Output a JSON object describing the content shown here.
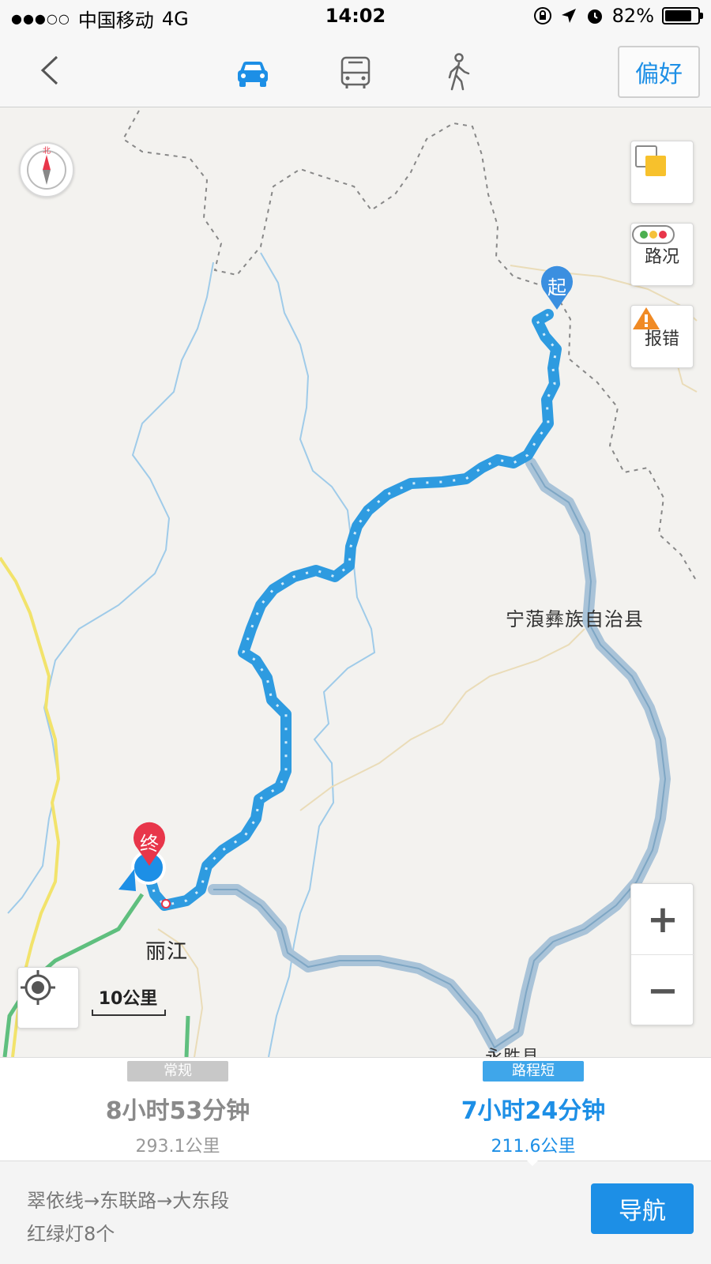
{
  "status_bar": {
    "signal": "●●●○○",
    "carrier": "中国移动",
    "network": "4G",
    "time": "14:02",
    "battery": "82%",
    "battery_fraction": 0.82
  },
  "nav": {
    "modes": [
      "car-icon",
      "bus-icon",
      "walk-icon"
    ],
    "active_mode": "car",
    "preference_label": "偏好"
  },
  "map": {
    "compass_label": "北",
    "county_label": "宁蒗彝族自治县",
    "city_label": "丽江",
    "bottom_label": "永胜县",
    "start_marker": "起",
    "end_marker": "终",
    "traffic_label": "路况",
    "report_label": "报错",
    "zoom_in": "+",
    "zoom_out": "−",
    "scale_text": "10公里"
  },
  "routes": [
    {
      "tag": "常规",
      "duration": "8小时53分钟",
      "distance": "293.1公里",
      "selected": false
    },
    {
      "tag": "路程短",
      "duration": "7小时24分钟",
      "distance": "211.6公里",
      "selected": true
    }
  ],
  "bottom": {
    "road_summary": "翠依线→东联路→大东段",
    "traffic_lights": "红绿灯8个",
    "navigate_label": "导航"
  },
  "colors": {
    "accent": "#1d8fe6",
    "route_main": "#2e9be0",
    "route_alt": "#a9c3d8",
    "start_pin": "#3b8fe0",
    "end_pin": "#e8364a"
  }
}
